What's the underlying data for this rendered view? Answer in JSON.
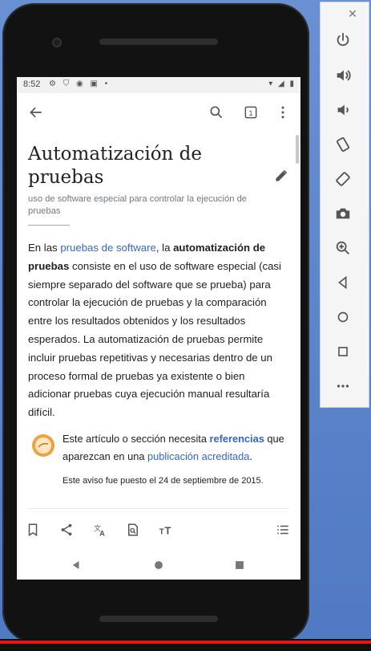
{
  "status_bar": {
    "time": "8:52"
  },
  "article": {
    "title": "Automatización de pruebas",
    "description": "uso de software especial para controlar la ejecución de pruebas",
    "p_intro": "En las ",
    "p_link": "pruebas de software",
    "p_mid": ", la ",
    "p_bold": "automatización de pruebas",
    "p_rest": " consiste en el uso de software especial (casi siempre separado del software que se prueba) para controlar la ejecución de pruebas y la comparación entre los resultados obtenidos y los resultados esperados. La automatización de pruebas permite incluir pruebas repetitivas y necesarias dentro de un proceso formal de pruebas ya existente o bien adicionar pruebas cuya ejecución manual resultaría difícil."
  },
  "notice": {
    "text_a": "Este artículo o sección necesita ",
    "link_a": "referencias",
    "text_b": " que aparezcan en una ",
    "link_b": "publicación acreditada",
    "text_c": ".",
    "small": "Este aviso fue puesto el 24 de septiembre de 2015."
  },
  "toolbar": {
    "tabs_count": "1"
  },
  "colors": {
    "link": "#3366cc",
    "notice_icon": "#f0a03c",
    "emulator_panel": "#f5f5f5"
  },
  "icons": {
    "toolbar": [
      "back-arrow-icon",
      "search-icon",
      "tabs-icon",
      "overflow-menu-icon"
    ],
    "bottom_toolbar": [
      "bookmark-icon",
      "share-icon",
      "translate-icon",
      "find-in-page-icon",
      "font-size-icon",
      "contents-list-icon"
    ],
    "emulator": [
      "power-icon",
      "volume-up-icon",
      "volume-down-icon",
      "rotate-left-icon",
      "rotate-right-icon",
      "camera-icon",
      "zoom-icon",
      "back-icon",
      "home-icon",
      "overview-icon",
      "more-icon"
    ]
  }
}
